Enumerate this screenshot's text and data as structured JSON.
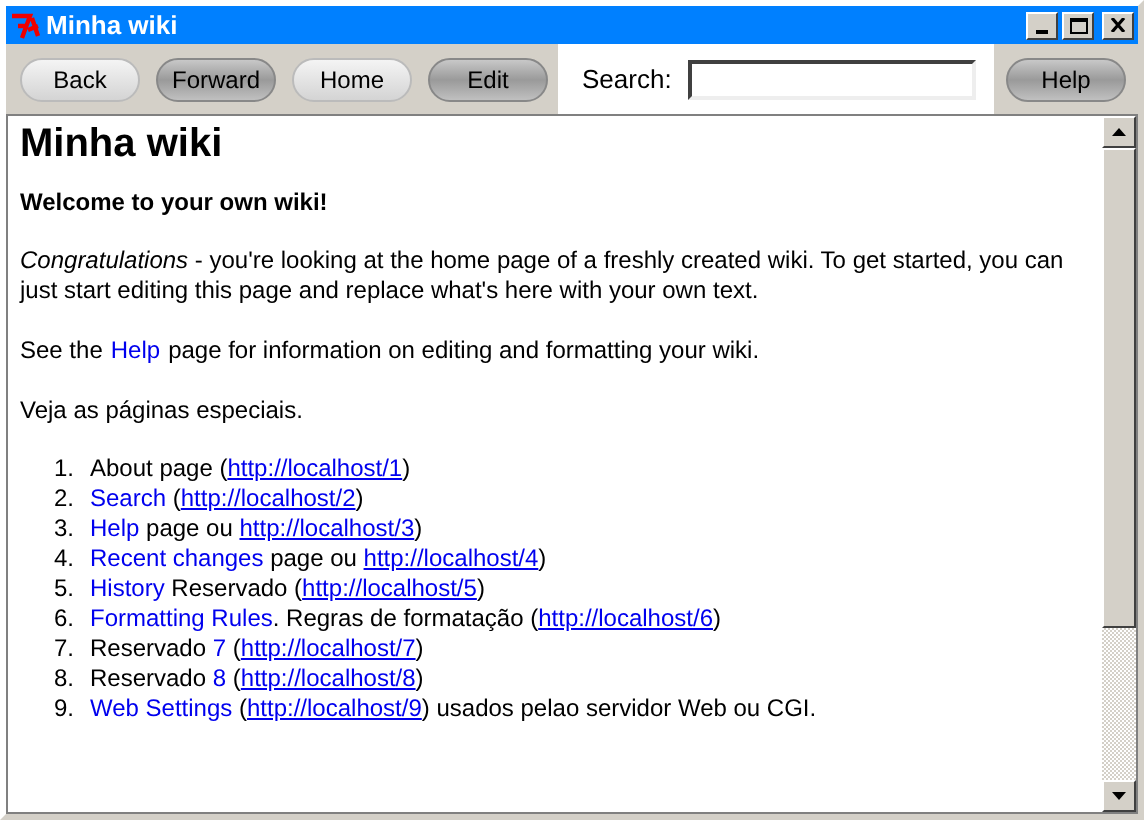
{
  "window": {
    "title": "Minha wiki"
  },
  "toolbar": {
    "buttons": [
      {
        "label": "Back",
        "kind": "light"
      },
      {
        "label": "Forward",
        "kind": "dark"
      },
      {
        "label": "Home",
        "kind": "light"
      },
      {
        "label": "Edit",
        "kind": "dark"
      }
    ],
    "search": {
      "label": "Search:"
    },
    "help": {
      "label": "Help",
      "kind": "dark"
    }
  },
  "page": {
    "heading": "Minha wiki",
    "welcome": "Welcome to your own wiki!",
    "intro": "*Congratulations* - you're looking at the home page of a freshly created wiki. To get started, you can just start editing this page and replace what's here with your own text.",
    "help_line": [
      {
        "kind": "text",
        "text": "See the"
      },
      {
        "kind": "link",
        "text": "Help"
      },
      {
        "kind": "text",
        "text": "page for information on editing and formatting your wiki."
      }
    ],
    "special": "Veja as páginas especiais.",
    "items": [
      {
        "number": "1.",
        "parts": [
          {
            "kind": "text",
            "text": "About page ("
          },
          {
            "kind": "url",
            "text": "http://localhost/1"
          },
          {
            "kind": "text",
            "text": ")"
          }
        ]
      },
      {
        "number": "2.",
        "parts": [
          {
            "kind": "link",
            "text": "Search"
          },
          {
            "kind": "text",
            "text": " ("
          },
          {
            "kind": "url",
            "text": "http://localhost/2"
          },
          {
            "kind": "text",
            "text": ")"
          }
        ]
      },
      {
        "number": "3.",
        "parts": [
          {
            "kind": "link",
            "text": "Help"
          },
          {
            "kind": "text",
            "text": " page ou "
          },
          {
            "kind": "url",
            "text": "http://localhost/3"
          },
          {
            "kind": "text",
            "text": ")"
          }
        ]
      },
      {
        "number": "4.",
        "parts": [
          {
            "kind": "link",
            "text": "Recent changes"
          },
          {
            "kind": "text",
            "text": " page ou "
          },
          {
            "kind": "url",
            "text": "http://localhost/4"
          },
          {
            "kind": "text",
            "text": ")"
          }
        ]
      },
      {
        "number": "5.",
        "parts": [
          {
            "kind": "link",
            "text": "History"
          },
          {
            "kind": "text",
            "text": " Reservado ("
          },
          {
            "kind": "url",
            "text": "http://localhost/5"
          },
          {
            "kind": "text",
            "text": ")"
          }
        ]
      },
      {
        "number": "6.",
        "parts": [
          {
            "kind": "link",
            "text": "Formatting Rules"
          },
          {
            "kind": "text",
            "text": ". Regras de formatação ("
          },
          {
            "kind": "url",
            "text": "http://localhost/6"
          },
          {
            "kind": "text",
            "text": ")"
          }
        ]
      },
      {
        "number": "7.",
        "parts": [
          {
            "kind": "text",
            "text": "Reservado "
          },
          {
            "kind": "link",
            "text": "7"
          },
          {
            "kind": "text",
            "text": " ("
          },
          {
            "kind": "url",
            "text": "http://localhost/7"
          },
          {
            "kind": "text",
            "text": ")"
          }
        ]
      },
      {
        "number": "8.",
        "parts": [
          {
            "kind": "text",
            "text": "Reservado "
          },
          {
            "kind": "link",
            "text": "8"
          },
          {
            "kind": "text",
            "text": " ("
          },
          {
            "kind": "url",
            "text": "http://localhost/8"
          },
          {
            "kind": "text",
            "text": ")"
          }
        ]
      },
      {
        "number": "9.",
        "parts": [
          {
            "kind": "link",
            "text": "Web Settings"
          },
          {
            "kind": "text",
            "text": " ("
          },
          {
            "kind": "url",
            "text": "http://localhost/9"
          },
          {
            "kind": "text",
            "text": ") usados pelao servidor Web ou CGI."
          }
        ]
      }
    ]
  }
}
